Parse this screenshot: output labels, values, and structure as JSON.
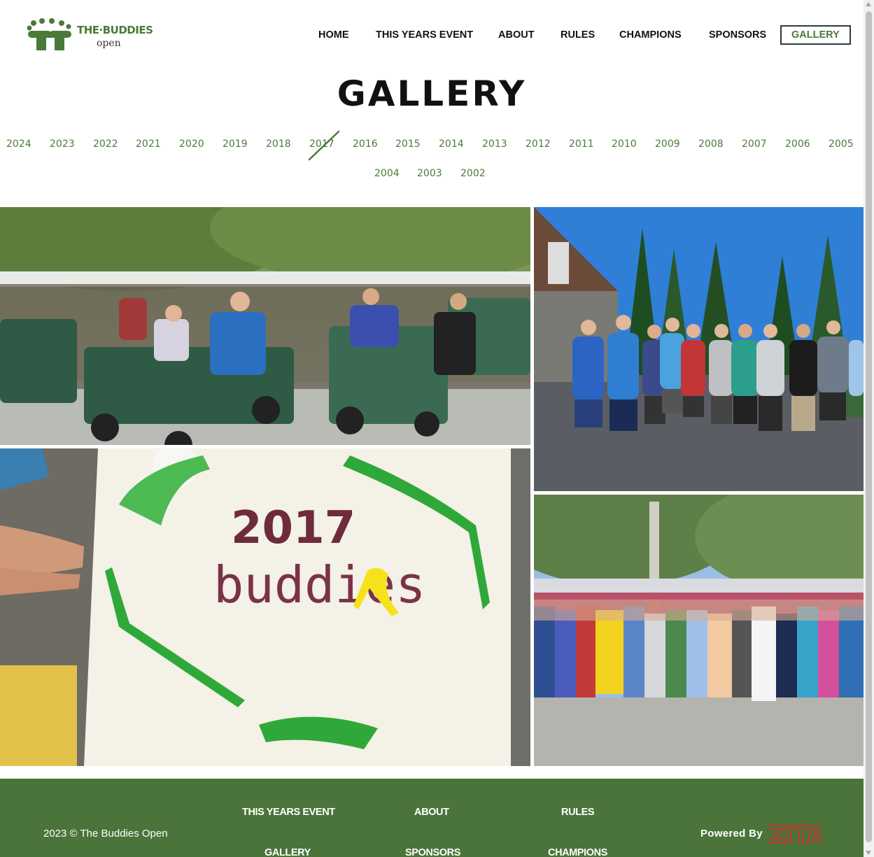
{
  "header": {
    "logo_title": "THE·BUDDIES",
    "logo_sub": "open",
    "nav": {
      "home": "HOME",
      "this_years_event": "THIS YEARS EVENT",
      "about": "ABOUT",
      "rules": "RULES",
      "champions": "CHAMPIONS",
      "sponsors": "SPONSORS",
      "gallery": "GALLERY"
    }
  },
  "page_title": "GALLERY",
  "years": [
    "2024",
    "2023",
    "2022",
    "2021",
    "2020",
    "2019",
    "2018",
    "2017",
    "2016",
    "2015",
    "2014",
    "2013",
    "2012",
    "2011",
    "2010",
    "2009",
    "2008",
    "2007",
    "2006",
    "2005",
    "2004",
    "2003",
    "2002"
  ],
  "selected_year": "2017",
  "photos": {
    "cake_year": "2017",
    "cake_word": "buddies"
  },
  "footer": {
    "copyright": "2023 © The Buddies Open",
    "links": {
      "this_years_event": "THIS YEARS EVENT",
      "about": "ABOUT",
      "rules": "RULES",
      "gallery": "GALLERY",
      "sponsors": "SPONSORS",
      "champions": "CHAMPIONS"
    },
    "powered_by": "Powered By",
    "brand": "ZITA"
  },
  "colors": {
    "accent_green": "#4a7a3a",
    "footer_bg": "#4b743a",
    "brand_red": "#e0272b"
  }
}
